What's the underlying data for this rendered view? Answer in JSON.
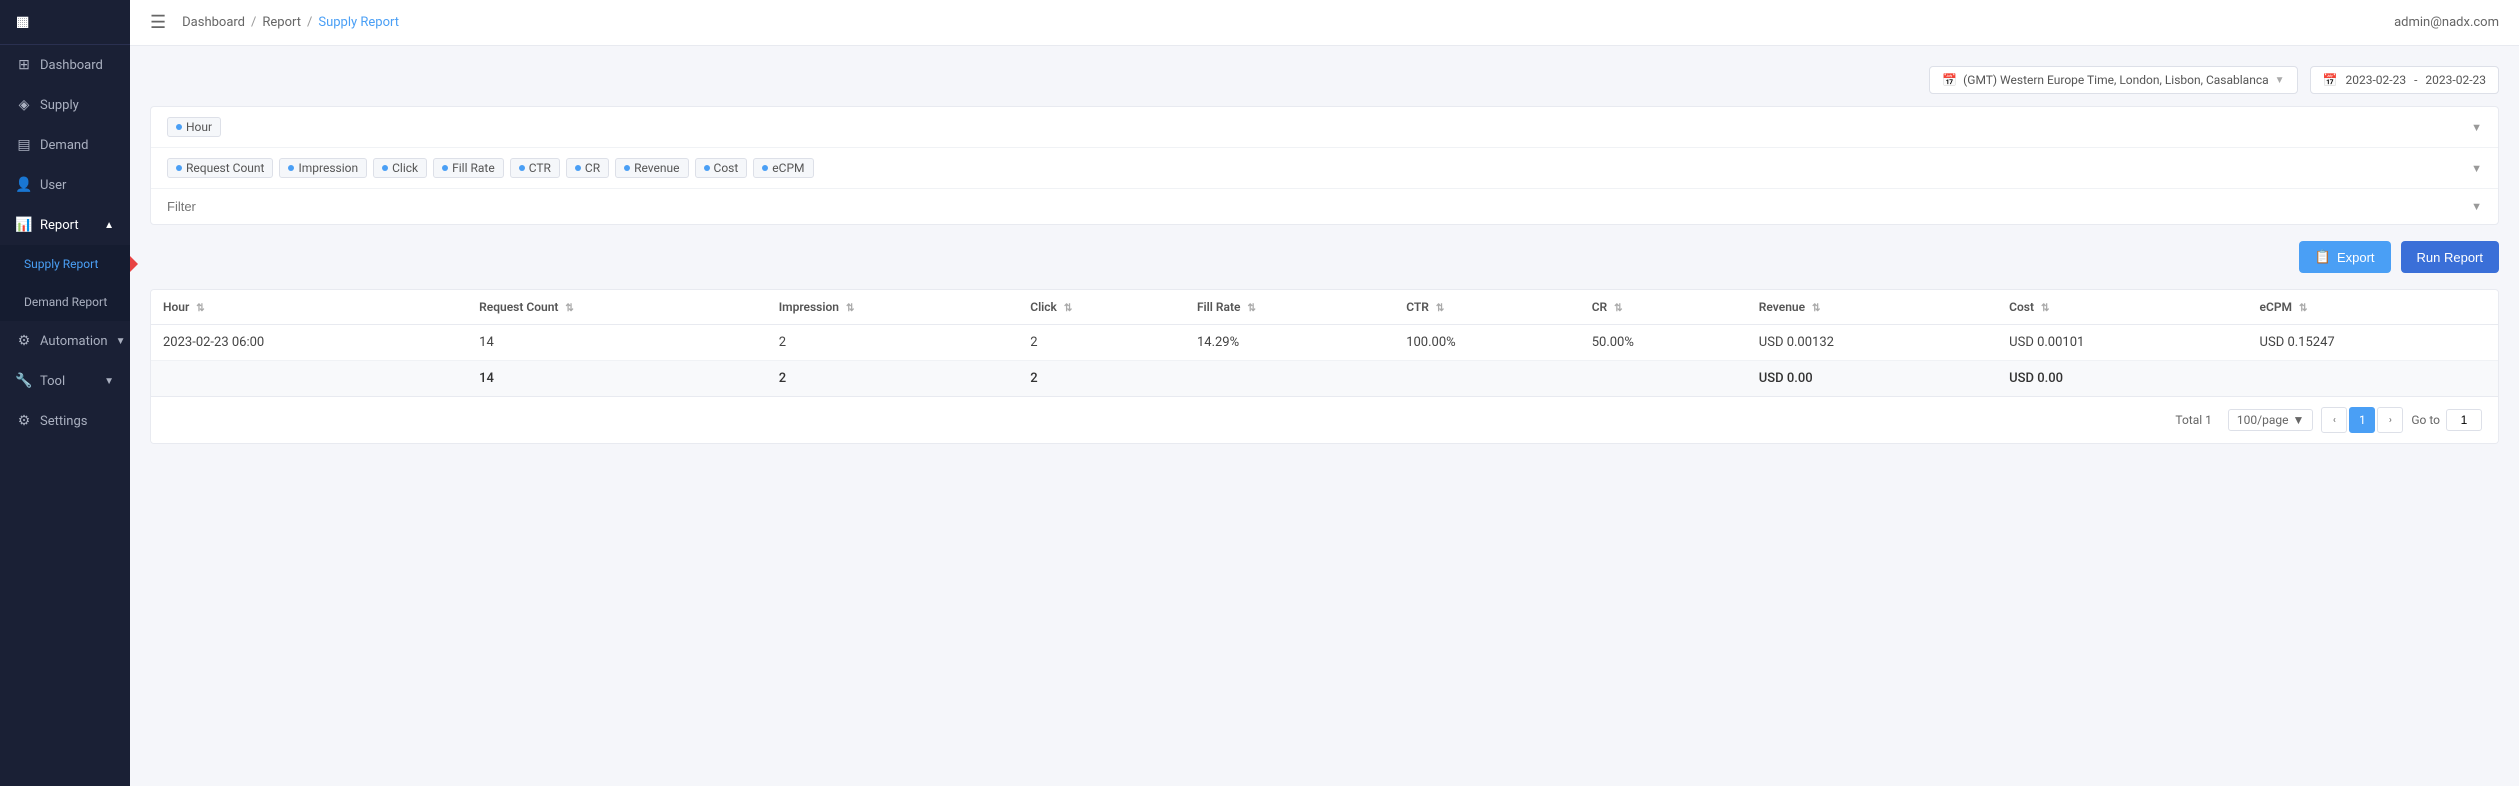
{
  "sidebar": {
    "logo_icon": "▦",
    "items": [
      {
        "id": "dashboard",
        "label": "Dashboard",
        "icon": "⊞",
        "active": false
      },
      {
        "id": "supply",
        "label": "Supply",
        "icon": "◈",
        "active": false
      },
      {
        "id": "demand",
        "label": "Demand",
        "icon": "▤",
        "active": false
      },
      {
        "id": "user",
        "label": "User",
        "icon": "👤",
        "active": false
      },
      {
        "id": "report",
        "label": "Report",
        "icon": "📊",
        "active": true,
        "expanded": true
      },
      {
        "id": "automation",
        "label": "Automation",
        "icon": "⚙",
        "active": false
      },
      {
        "id": "tool",
        "label": "Tool",
        "icon": "🔧",
        "active": false
      },
      {
        "id": "settings",
        "label": "Settings",
        "icon": "⚙",
        "active": false
      }
    ],
    "report_sub": [
      {
        "id": "supply-report",
        "label": "Supply Report",
        "active": true
      },
      {
        "id": "demand-report",
        "label": "Demand Report",
        "active": false
      }
    ]
  },
  "header": {
    "breadcrumb": {
      "dashboard": "Dashboard",
      "report": "Report",
      "current": "Supply Report"
    },
    "user_email": "admin@nadx.com"
  },
  "filters": {
    "timezone_label": "(GMT) Western Europe Time, London, Lisbon, Casablanca",
    "date_start": "2023-02-23",
    "date_separator": "-",
    "date_end": "2023-02-23",
    "group_by_label": "Hour",
    "metrics": [
      {
        "id": "request-count",
        "label": "Request Count",
        "active": true
      },
      {
        "id": "impression",
        "label": "Impression",
        "active": true
      },
      {
        "id": "click",
        "label": "Click",
        "active": true
      },
      {
        "id": "fill-rate",
        "label": "Fill Rate",
        "active": true
      },
      {
        "id": "ctr",
        "label": "CTR",
        "active": true
      },
      {
        "id": "cr",
        "label": "CR",
        "active": true
      },
      {
        "id": "revenue",
        "label": "Revenue",
        "active": true
      },
      {
        "id": "cost",
        "label": "Cost",
        "active": true
      },
      {
        "id": "ecpm",
        "label": "eCPM",
        "active": true
      }
    ],
    "filter_placeholder": "Filter"
  },
  "buttons": {
    "export": "Export",
    "run_report": "Run Report"
  },
  "table": {
    "columns": [
      {
        "id": "hour",
        "label": "Hour"
      },
      {
        "id": "request-count",
        "label": "Request Count"
      },
      {
        "id": "impression",
        "label": "Impression"
      },
      {
        "id": "click",
        "label": "Click"
      },
      {
        "id": "fill-rate",
        "label": "Fill Rate"
      },
      {
        "id": "ctr",
        "label": "CTR"
      },
      {
        "id": "cr",
        "label": "CR"
      },
      {
        "id": "revenue",
        "label": "Revenue"
      },
      {
        "id": "cost",
        "label": "Cost"
      },
      {
        "id": "ecpm",
        "label": "eCPM"
      }
    ],
    "rows": [
      {
        "hour": "2023-02-23 06:00",
        "request_count": "14",
        "impression": "2",
        "click": "2",
        "fill_rate": "14.29%",
        "ctr": "100.00%",
        "cr": "50.00%",
        "revenue": "USD 0.00132",
        "cost": "USD 0.00101",
        "ecpm": "USD 0.15247"
      }
    ],
    "summary": {
      "hour": "",
      "request_count": "14",
      "impression": "2",
      "click": "2",
      "fill_rate": "",
      "ctr": "",
      "cr": "",
      "revenue": "USD 0.00",
      "cost": "USD 0.00",
      "ecpm": ""
    }
  },
  "pagination": {
    "total_label": "Total 1",
    "per_page": "100/page",
    "current_page": 1,
    "goto_label": "Go to",
    "goto_value": "1"
  }
}
